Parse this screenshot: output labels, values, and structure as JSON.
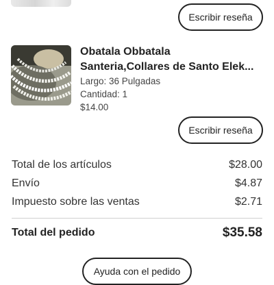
{
  "product": {
    "title_line1": "Obatala Obbatala",
    "title_line2": "Santeria,Collares de Santo Elek...",
    "length": "Largo: 36 Pulgadas",
    "quantity": "Cantidad: 1",
    "price": "$14.00"
  },
  "buttons": {
    "write_review": "Escribir reseña",
    "order_help": "Ayuda con el pedido"
  },
  "summary": {
    "rows": [
      {
        "label": "Total de los artículos",
        "value": "$28.00"
      },
      {
        "label": "Envío",
        "value": "$4.87"
      },
      {
        "label": "Impuesto sobre las ventas",
        "value": "$2.71"
      }
    ],
    "total_label": "Total del pedido",
    "total_value": "$35.58"
  },
  "colors": {
    "text": "#222222",
    "divider": "#d0d0d0"
  }
}
